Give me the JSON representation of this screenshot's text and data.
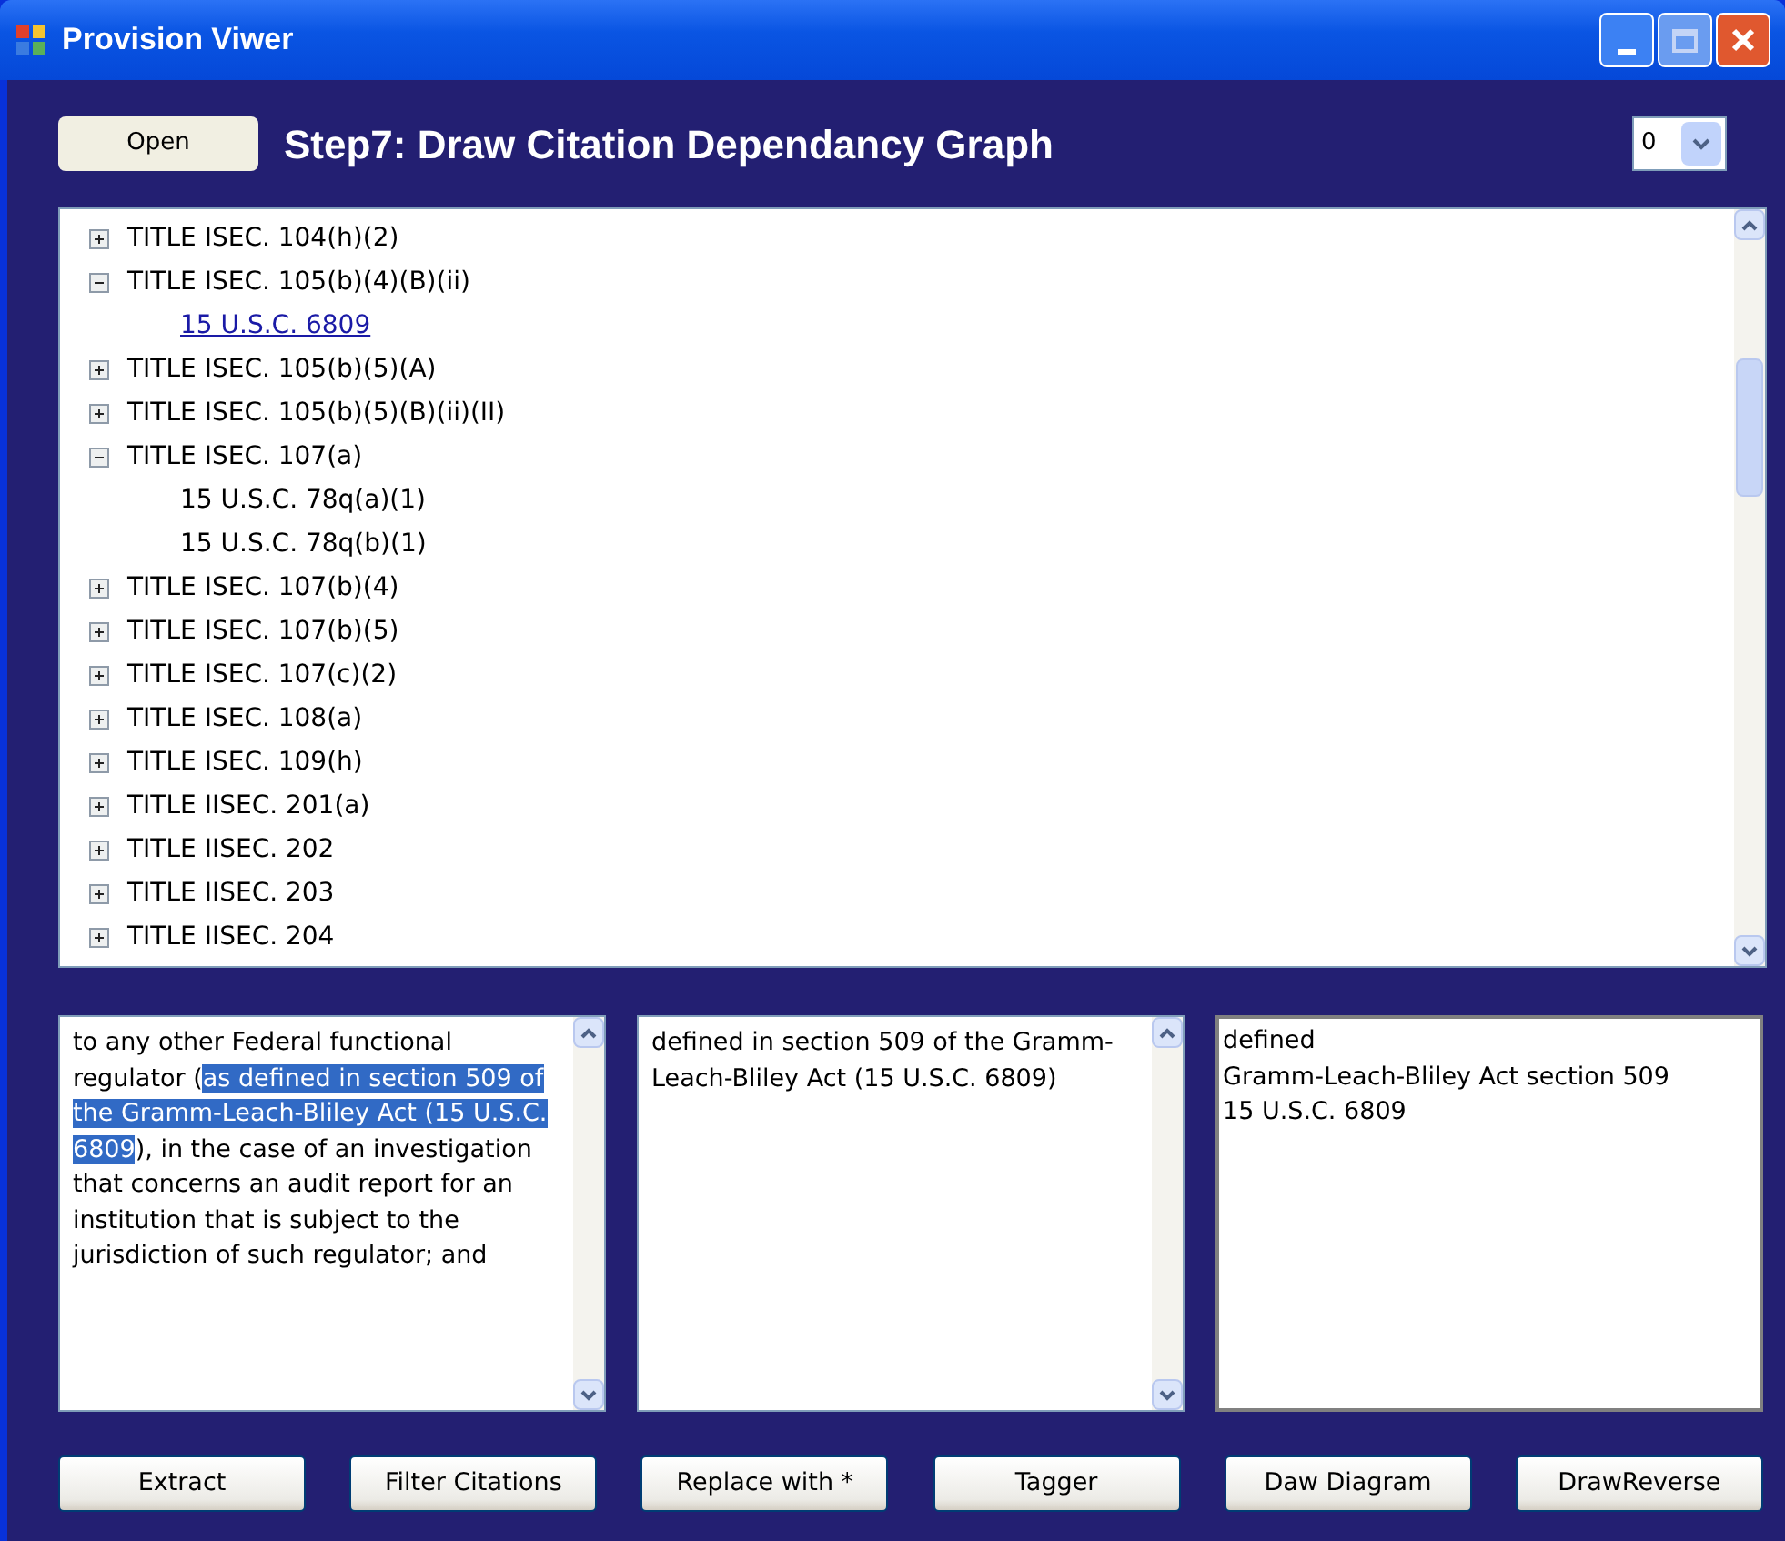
{
  "window": {
    "title": "Provision Viwer"
  },
  "toolbar": {
    "open_button": "Open",
    "step_title": "Step7: Draw Citation Dependancy Graph",
    "dropdown_value": "0"
  },
  "tree": {
    "items": [
      {
        "label": "TITLE ISEC. 104(h)(2)",
        "expanded": false
      },
      {
        "label": "TITLE ISEC. 105(b)(4)(B)(ii)",
        "expanded": true,
        "children": [
          {
            "label": "15 U.S.C. 6809",
            "selected": true
          }
        ]
      },
      {
        "label": "TITLE ISEC. 105(b)(5)(A)",
        "expanded": false
      },
      {
        "label": "TITLE ISEC. 105(b)(5)(B)(ii)(II)",
        "expanded": false
      },
      {
        "label": "TITLE ISEC. 107(a)",
        "expanded": true,
        "children": [
          {
            "label": "15 U.S.C. 78q(a)(1)",
            "selected": false
          },
          {
            "label": "15 U.S.C. 78q(b)(1)",
            "selected": false
          }
        ]
      },
      {
        "label": "TITLE ISEC. 107(b)(4)",
        "expanded": false
      },
      {
        "label": "TITLE ISEC. 107(b)(5)",
        "expanded": false
      },
      {
        "label": "TITLE ISEC. 107(c)(2)",
        "expanded": false
      },
      {
        "label": "TITLE ISEC. 108(a)",
        "expanded": false
      },
      {
        "label": "TITLE ISEC. 109(h)",
        "expanded": false
      },
      {
        "label": "TITLE IISEC. 201(a)",
        "expanded": false
      },
      {
        "label": "TITLE IISEC. 202",
        "expanded": false
      },
      {
        "label": "TITLE IISEC. 203",
        "expanded": false
      },
      {
        "label": "TITLE IISEC. 204",
        "expanded": false
      }
    ]
  },
  "source_text": {
    "before": "to any other Federal functional regulator (",
    "selected": "as defined in section 509 of the Gramm-Leach-Bliley Act (15 U.S.C. 6809",
    "after": "), in the case of an investigation that concerns an audit report for an institution that is subject to the jurisdiction of such regulator; and"
  },
  "citation_text": "defined in section 509 of the Gramm-Leach-Bliley Act (15 U.S.C. 6809)",
  "tagged_lines": [
    "defined",
    "Gramm-Leach-Bliley Act section 509",
    "15 U.S.C. 6809"
  ],
  "buttons": [
    "Extract",
    "Filter Citations",
    "Replace with *",
    "Tagger",
    "Daw Diagram",
    "DrawReverse"
  ]
}
